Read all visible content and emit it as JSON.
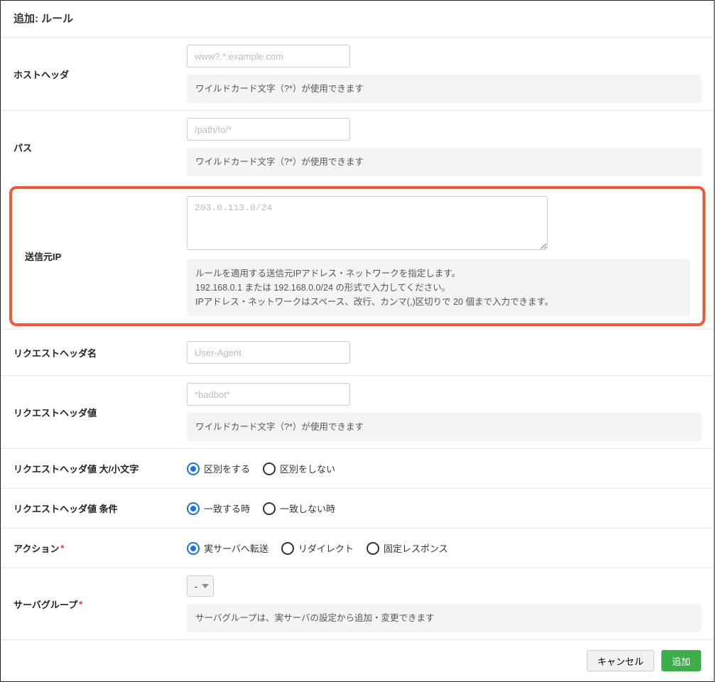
{
  "title": "追加: ルール",
  "fields": {
    "hostHeader": {
      "label": "ホストヘッダ",
      "placeholder": "www?.*.example.com",
      "help": "ワイルドカード文字（?*）が使用できます"
    },
    "path": {
      "label": "パス",
      "placeholder": "/path/to/*",
      "help": "ワイルドカード文字（?*）が使用できます"
    },
    "sourceIp": {
      "label": "送信元IP",
      "placeholder": "203.0.113.0/24",
      "help1": "ルールを適用する送信元IPアドレス・ネットワークを指定します。",
      "help2": "192.168.0.1 または 192.168.0.0/24 の形式で入力してください。",
      "help3": "IPアドレス・ネットワークはスペース、改行、カンマ(,)区切りで 20 個まで入力できます。"
    },
    "reqHeaderName": {
      "label": "リクエストヘッダ名",
      "placeholder": "User-Agent"
    },
    "reqHeaderValue": {
      "label": "リクエストヘッダ値",
      "placeholder": "*badbot*",
      "help": "ワイルドカード文字（?*）が使用できます"
    },
    "caseSensitive": {
      "label": "リクエストヘッダ値 大/小文字",
      "opt1": "区別をする",
      "opt2": "区別をしない",
      "selected": 0
    },
    "matchCond": {
      "label": "リクエストヘッダ値 条件",
      "opt1": "一致する時",
      "opt2": "一致しない時",
      "selected": 0
    },
    "action": {
      "label": "アクション",
      "opt1": "実サーバへ転送",
      "opt2": "リダイレクト",
      "opt3": "固定レスポンス",
      "selected": 0
    },
    "serverGroup": {
      "label": "サーバグループ",
      "selected": "-",
      "help": "サーバグループは、実サーバの設定から追加・変更できます"
    }
  },
  "buttons": {
    "cancel": "キャンセル",
    "submit": "追加"
  },
  "requiredMark": "*"
}
